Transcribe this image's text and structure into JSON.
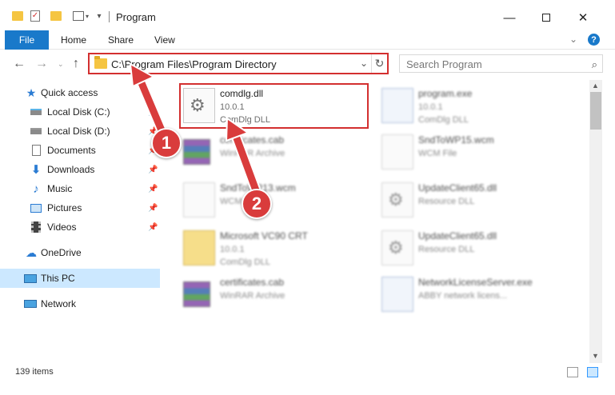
{
  "window": {
    "title": "Program",
    "minimize_icon": "minimize-icon",
    "maximize_icon": "maximize-icon",
    "close_icon": "close-icon"
  },
  "ribbon": {
    "file_label": "File",
    "tabs": [
      {
        "label": "Home"
      },
      {
        "label": "Share"
      },
      {
        "label": "View"
      }
    ],
    "help_label": "?"
  },
  "navigation": {
    "address": "C:\\Program Files\\Program Directory",
    "search_placeholder": "Search Program"
  },
  "sidebar": {
    "items": [
      {
        "label": "Quick access",
        "icon": "star-icon"
      },
      {
        "label": "Local Disk (C:)",
        "icon": "drive-icon"
      },
      {
        "label": "Local Disk (D:)",
        "icon": "drive-icon"
      },
      {
        "label": "Documents",
        "icon": "documents-icon"
      },
      {
        "label": "Downloads",
        "icon": "download-icon"
      },
      {
        "label": "Music",
        "icon": "music-icon"
      },
      {
        "label": "Pictures",
        "icon": "pictures-icon"
      },
      {
        "label": "Videos",
        "icon": "videos-icon"
      },
      {
        "label": "OneDrive",
        "icon": "cloud-icon"
      },
      {
        "label": "This PC",
        "icon": "computer-icon"
      },
      {
        "label": "Network",
        "icon": "network-icon"
      }
    ]
  },
  "files": [
    {
      "name": "comdlg.dll",
      "line2": "10.0.1",
      "line3": "ComDlg DLL",
      "icon": "dll-icon"
    },
    {
      "name": "program.exe",
      "line2": "10.0.1",
      "line3": "ComDlg DLL",
      "icon": "exe-icon"
    },
    {
      "name": "certificates.cab",
      "line2": "WinRAR Archive",
      "line3": "",
      "icon": "archive-icon"
    },
    {
      "name": "SndToWP15.wcm",
      "line2": "WCM File",
      "line3": "",
      "icon": "document-icon"
    },
    {
      "name": "SndToWP13.wcm",
      "line2": "WCM File",
      "line3": "",
      "icon": "document-icon"
    },
    {
      "name": "UpdateClient65.dll",
      "line2": "Resource DLL",
      "line3": "",
      "icon": "dll-icon"
    },
    {
      "name": "Microsoft VC90 CRT",
      "line2": "10.0.1",
      "line3": "ComDlg DLL",
      "icon": "zip-icon"
    },
    {
      "name": "UpdateClient65.dll",
      "line2": "Resource DLL",
      "line3": "",
      "icon": "dll-icon"
    },
    {
      "name": "certificates.cab",
      "line2": "WinRAR Archive",
      "line3": "",
      "icon": "archive-icon"
    },
    {
      "name": "NetworkLicenseServer.exe",
      "line2": "ABBY network licens...",
      "line3": "",
      "icon": "exe-icon"
    }
  ],
  "annotations": {
    "step1": "1",
    "step2": "2",
    "highlight_color": "#d32f2f",
    "badge_color": "#d93c3c"
  },
  "status": {
    "item_count": "139 items"
  },
  "colors": {
    "accent": "#1979ca",
    "selection": "#cce8ff"
  }
}
